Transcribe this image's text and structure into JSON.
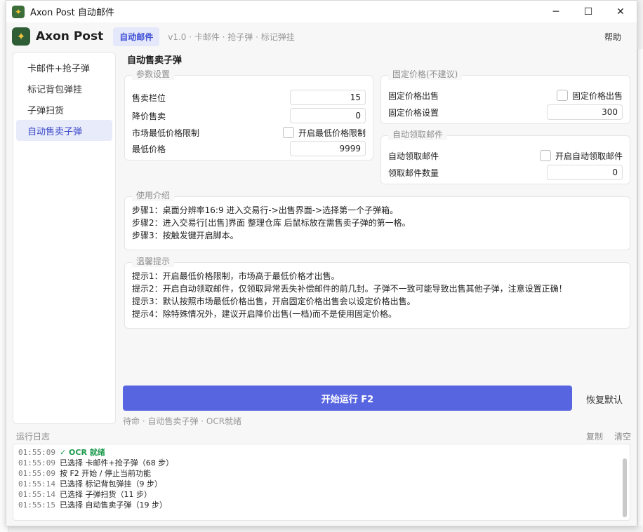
{
  "window": {
    "title": "Axon Post 自动邮件",
    "icon": "app-icon"
  },
  "header": {
    "brand": "Axon Post",
    "mode": "自动邮件",
    "version": "v1.0 · 卡邮件 · 抢子弹 · 标记弹挂",
    "help": "帮助"
  },
  "sidebar": {
    "items": [
      {
        "label": "卡邮件+抢子弹"
      },
      {
        "label": "标记背包弹挂"
      },
      {
        "label": "子弹扫货"
      },
      {
        "label": "自动售卖子弹"
      }
    ],
    "active_index": 3
  },
  "section_title": "自动售卖子弹",
  "params": {
    "label": "参数设置",
    "sell_slot_label": "售卖栏位",
    "sell_slot_value": "15",
    "reduce_label": "降价售卖",
    "reduce_value": "0",
    "min_limit_label": "市场最低价格限制",
    "min_limit_check": "开启最低价格限制",
    "min_price_label": "最低价格",
    "min_price_value": "9999"
  },
  "fixed_price": {
    "label": "固定价格(不建议)",
    "sell_label": "固定价格出售",
    "sell_check": "固定价格出售",
    "set_label": "固定价格设置",
    "set_value": "300"
  },
  "auto_claim": {
    "label": "自动领取邮件",
    "claim_label": "自动领取邮件",
    "claim_check": "开启自动领取邮件",
    "count_label": "领取邮件数量",
    "count_value": "0"
  },
  "usage": {
    "label": "使用介绍",
    "lines": [
      "步骤1：桌面分辨率16:9 进入交易行->出售界面->选择第一个子弹箱。",
      "步骤2：进入交易行[出售]界面 整理仓库 后鼠标放在需售卖子弹的第一格。",
      "步骤3：按触发键开启脚本。"
    ]
  },
  "tips": {
    "label": "温馨提示",
    "lines": [
      "提示1：开启最低价格限制，市场高于最低价格才出售。",
      "提示2：开启自动领取邮件，仅领取异常丢失补偿邮件的前几封。子弹不一致可能导致出售其他子弹，注意设置正确！",
      "提示3：默认按照市场最低价格出售，开启固定价格出售会以设定价格出售。",
      "提示4：除特殊情况外，建议开启降价出售(一档)而不是使用固定价格。"
    ]
  },
  "actions": {
    "run": "开始运行  F2",
    "reset": "恢复默认"
  },
  "status": "待命  ·  自动售卖子弹  ·  OCR就绪",
  "log": {
    "title": "运行日志",
    "copy": "复制",
    "clear": "清空",
    "entries": [
      {
        "time": "01:55:09",
        "msg": "✓ OCR 就绪",
        "ok": true
      },
      {
        "time": "01:55:09",
        "msg": "已选择 卡邮件+抢子弹（68 步）"
      },
      {
        "time": "01:55:09",
        "msg": "按 F2 开始 / 停止当前功能"
      },
      {
        "time": "01:55:14",
        "msg": "已选择 标记背包弹挂（9 步）"
      },
      {
        "time": "01:55:14",
        "msg": "已选择 子弹扫货（11 步）"
      },
      {
        "time": "01:55:15",
        "msg": "已选择 自动售卖子弹（19 步）"
      }
    ]
  },
  "colors": {
    "accent": "#5865e0",
    "ok": "#1d9a4d"
  }
}
